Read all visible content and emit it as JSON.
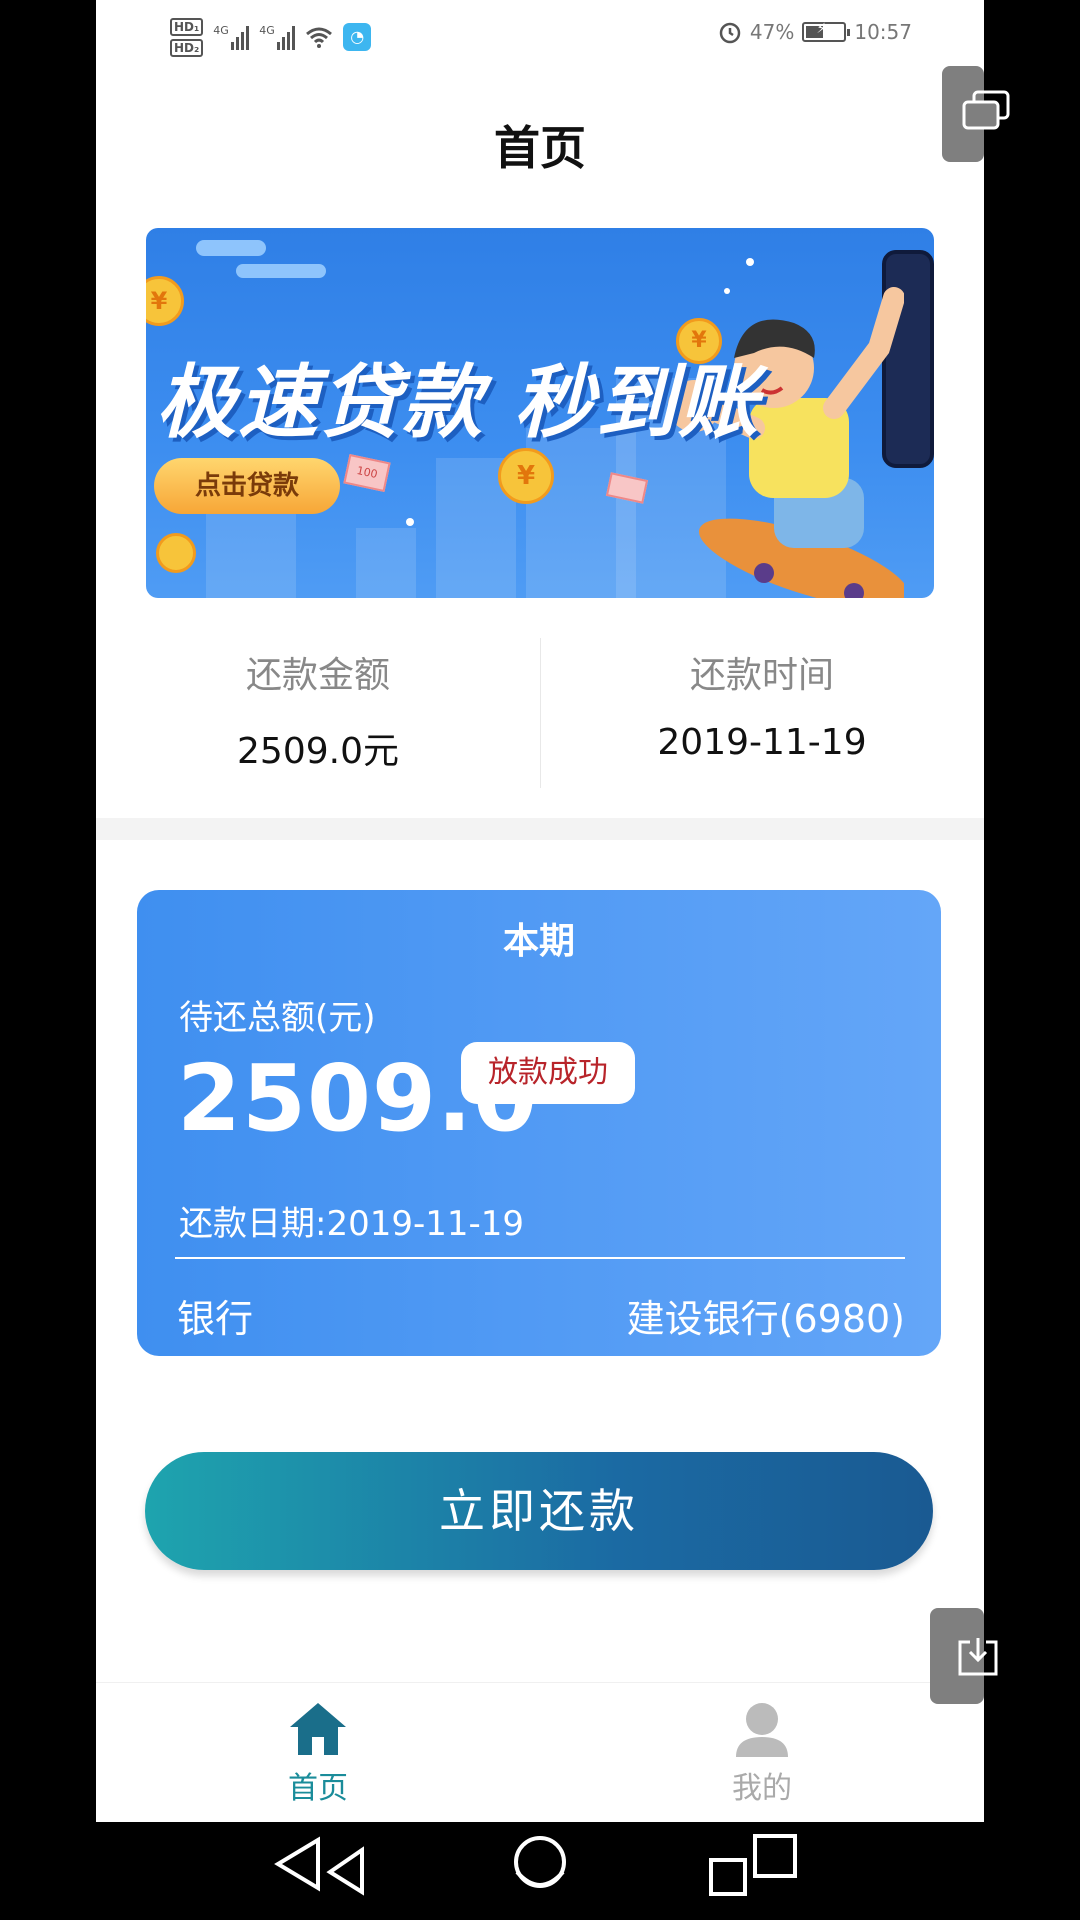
{
  "status_bar": {
    "hd1": "HD₁",
    "hd2": "HD₂",
    "net1": "4G",
    "net2": "4G",
    "battery_percent": "47%",
    "battery_level": 0.47,
    "time": "10:57",
    "icons": [
      "signal-icon",
      "wifi-icon",
      "app-notification-icon",
      "alarm-icon",
      "battery-charging-icon"
    ]
  },
  "page_title": "首页",
  "banner": {
    "slogan": "极速贷款 秒到账",
    "button": "点击贷款",
    "bill_label": "100"
  },
  "summary": {
    "amount_label": "还款金额",
    "amount_value": "2509.0元",
    "date_label": "还款时间",
    "date_value": "2019-11-19"
  },
  "current_period": {
    "title": "本期",
    "due_label": "待还总额(元)",
    "due_amount": "2509.0",
    "status_badge": "放款成功",
    "repay_date": "还款日期:2019-11-19",
    "bank_label": "银行",
    "bank_value": "建设银行(6980)"
  },
  "repay_button": "立即还款",
  "tabs": [
    {
      "label": "首页",
      "icon": "home-icon",
      "active": true
    },
    {
      "label": "我的",
      "icon": "person-icon",
      "active": false
    }
  ],
  "colors": {
    "card_start": "#3f8ff0",
    "card_end": "#64a6f8",
    "button_start": "#1ea4ae",
    "button_end": "#1a5a92",
    "active_tab": "#1a8c9a",
    "badge_text": "#b8242a"
  }
}
